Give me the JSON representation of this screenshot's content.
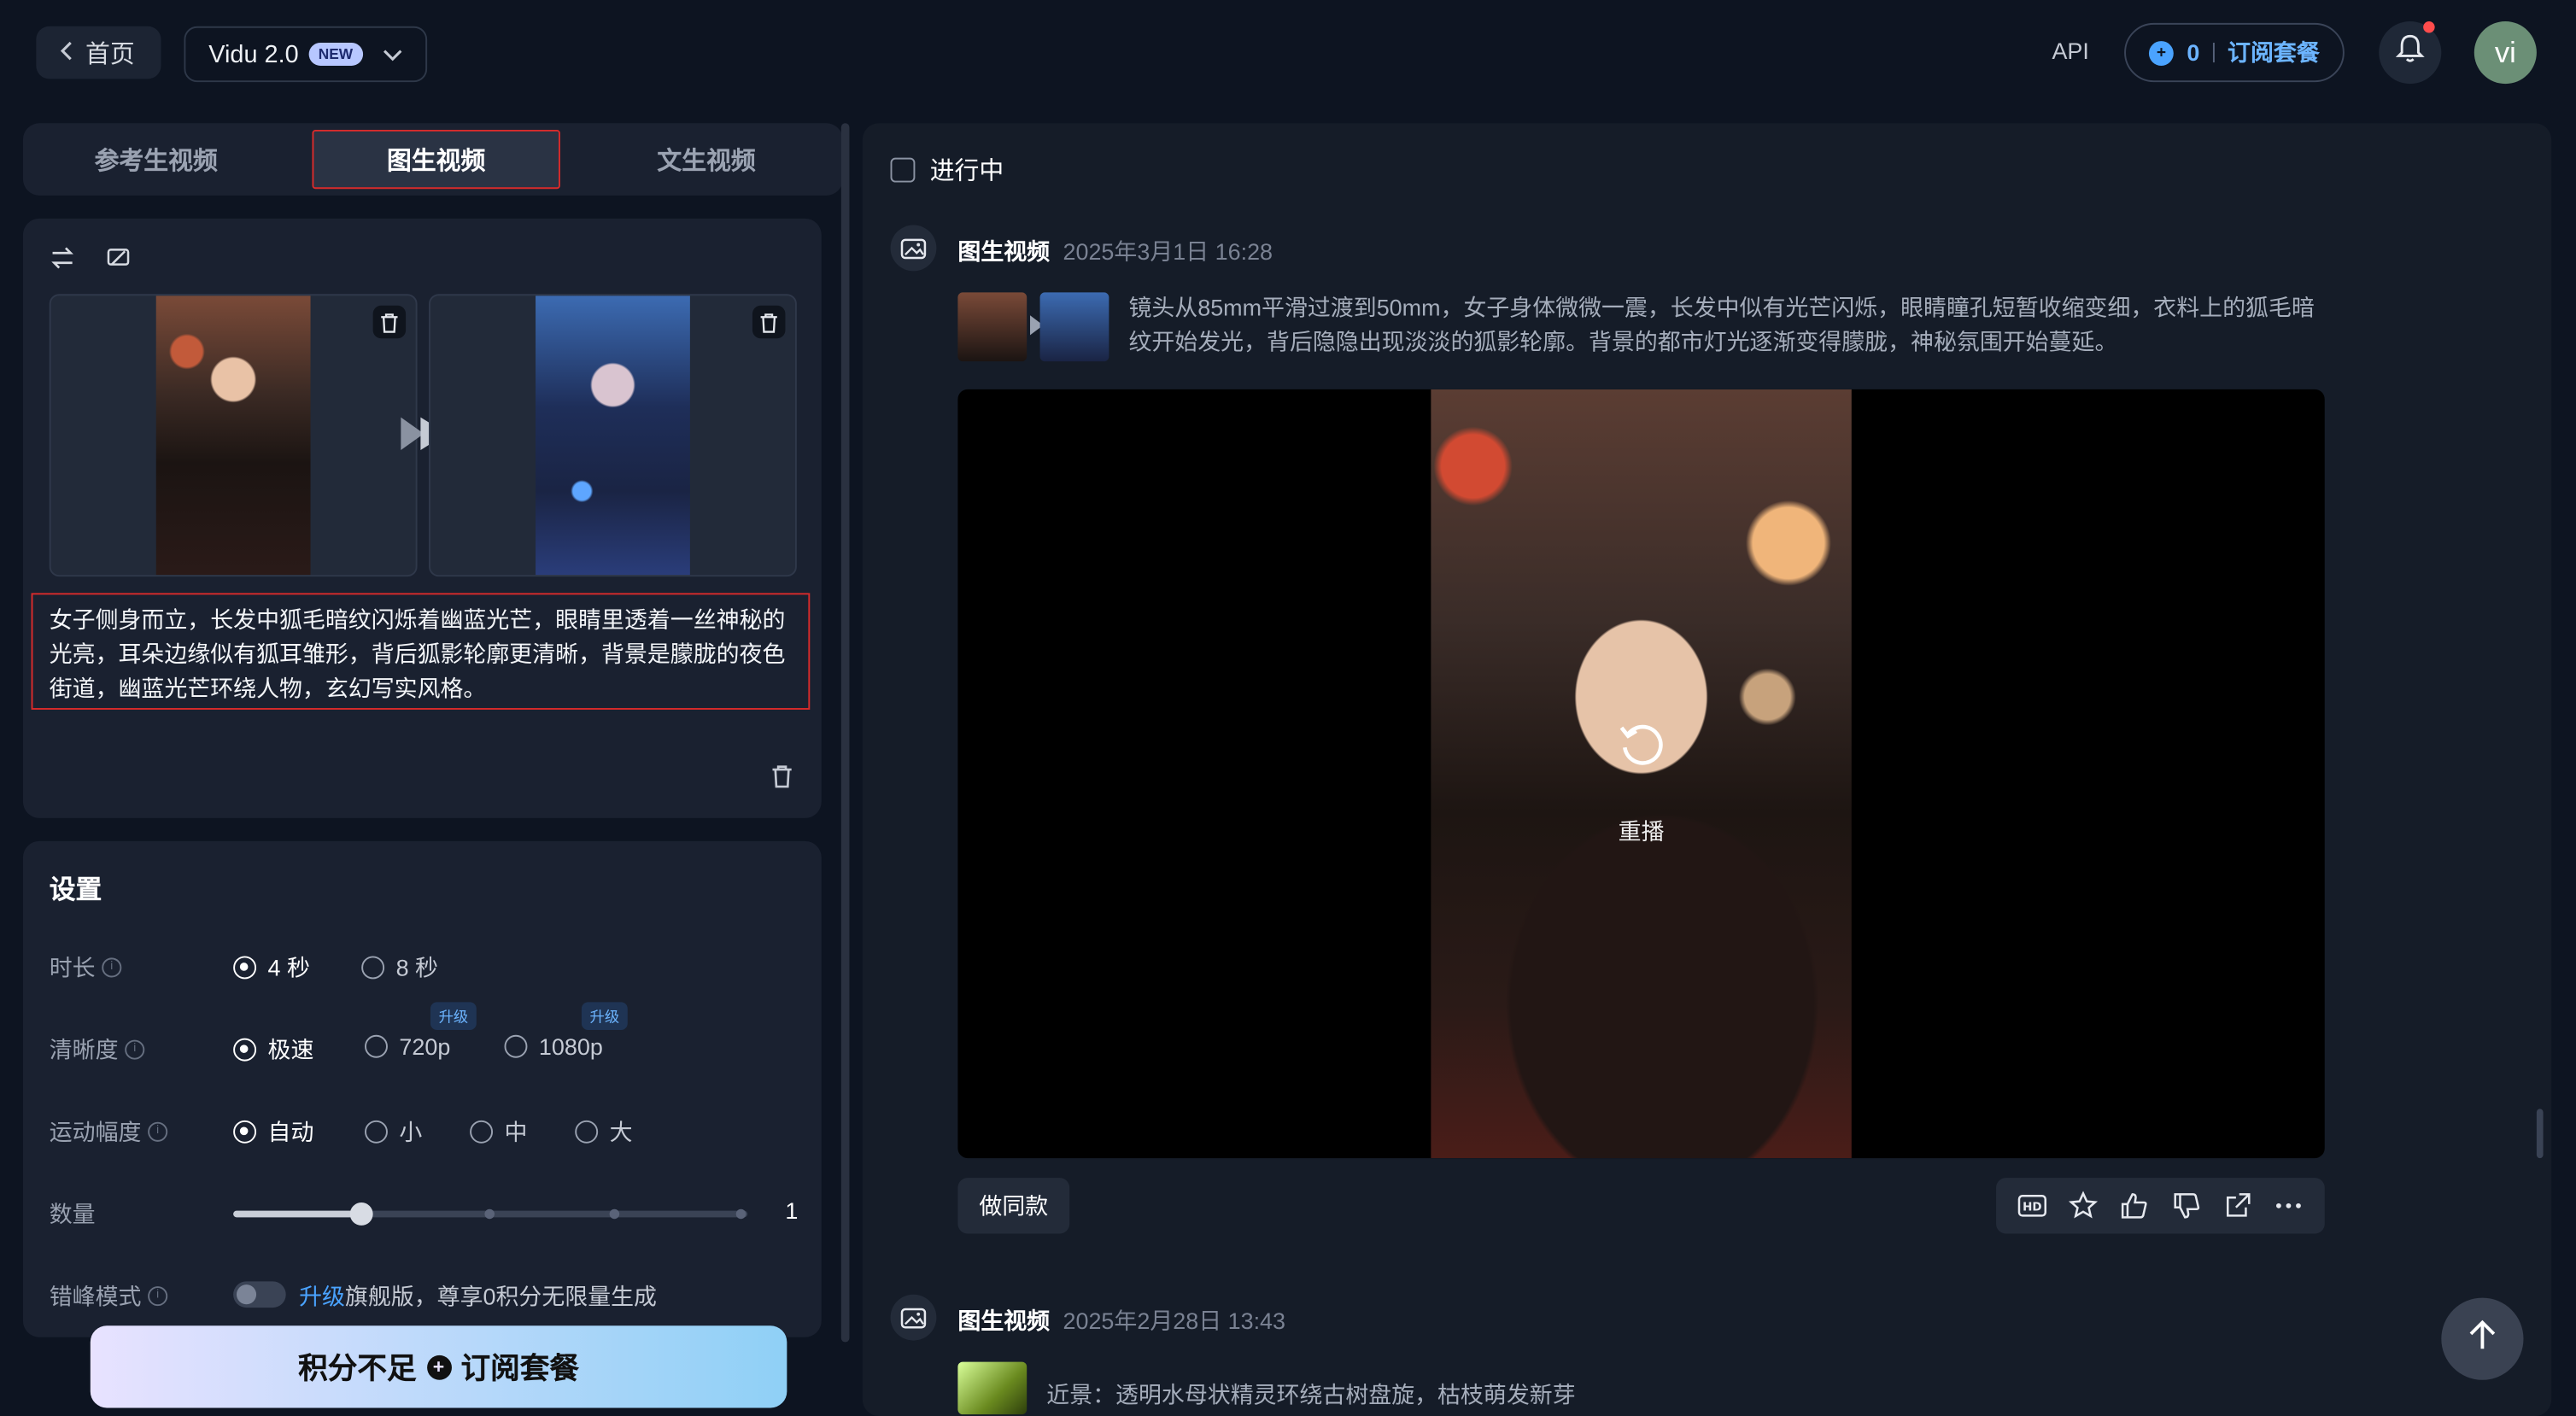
{
  "topbar": {
    "home_label": "首页",
    "model_name": "Vidu 2.0",
    "model_badge": "NEW",
    "api_label": "API",
    "credits_value": "0",
    "subscribe_label": "订阅套餐",
    "avatar_initials": "vi"
  },
  "mode_tabs": [
    {
      "label": "参考生视频",
      "active": false
    },
    {
      "label": "图生视频",
      "active": true
    },
    {
      "label": "文生视频",
      "active": false
    }
  ],
  "input": {
    "prompt": "女子侧身而立，长发中狐毛暗纹闪烁着幽蓝光芒，眼睛里透着一丝神秘的光亮，耳朵边缘似有狐耳雏形，背后狐影轮廓更清晰，背景是朦胧的夜色街道，幽蓝光芒环绕人物，玄幻写实风格。"
  },
  "settings": {
    "title": "设置",
    "duration": {
      "label": "时长",
      "options": [
        "4 秒",
        "8 秒"
      ],
      "selected": "4 秒"
    },
    "resolution": {
      "label": "清晰度",
      "options": [
        "极速",
        "720p",
        "1080p"
      ],
      "selected": "极速",
      "upgrade_tag": "升级"
    },
    "motion": {
      "label": "运动幅度",
      "options": [
        "自动",
        "小",
        "中",
        "大"
      ],
      "selected": "自动"
    },
    "quantity": {
      "label": "数量",
      "value": "1",
      "slider_fraction": 0.25
    },
    "offpeak": {
      "label": "错峰模式",
      "upgrade_link": "升级",
      "note": "旗舰版，尊享0积分无限量生成",
      "enabled": false
    }
  },
  "cta": {
    "label_left": "积分不足",
    "label_right": "订阅套餐"
  },
  "feed": {
    "filter_label": "进行中",
    "entries": [
      {
        "title": "图生视频",
        "time": "2025年3月1日 16:28",
        "prompt": "镜头从85mm平滑过渡到50mm，女子身体微微一震，长发中似有光芒闪烁，眼睛瞳孔短暂收缩变细，衣料上的狐毛暗纹开始发光，背后隐隐出现淡淡的狐影轮廓。背景的都市灯光逐渐变得朦胧，神秘氛围开始蔓延。",
        "replay_label": "重播",
        "same_button": "做同款"
      },
      {
        "title": "图生视频",
        "time": "2025年2月28日 13:43",
        "prompt": "近景：透明水母状精灵环绕古树盘旋，枯枝萌发新芽"
      }
    ]
  },
  "colors": {
    "accent_blue": "#6cb4ff",
    "highlight_red": "#d92b2b",
    "bg": "#0d1421",
    "panel": "#1a2130"
  },
  "icons": [
    "chevron-left-icon",
    "chevron-down-icon",
    "plus-coin-icon",
    "bell-icon",
    "swap-icon",
    "crop-icon",
    "trash-icon",
    "play-forward-icon",
    "image-icon",
    "replay-icon",
    "hd-icon",
    "star-icon",
    "thumbs-up-icon",
    "thumbs-down-icon",
    "share-icon",
    "more-icon",
    "arrow-up-icon"
  ]
}
